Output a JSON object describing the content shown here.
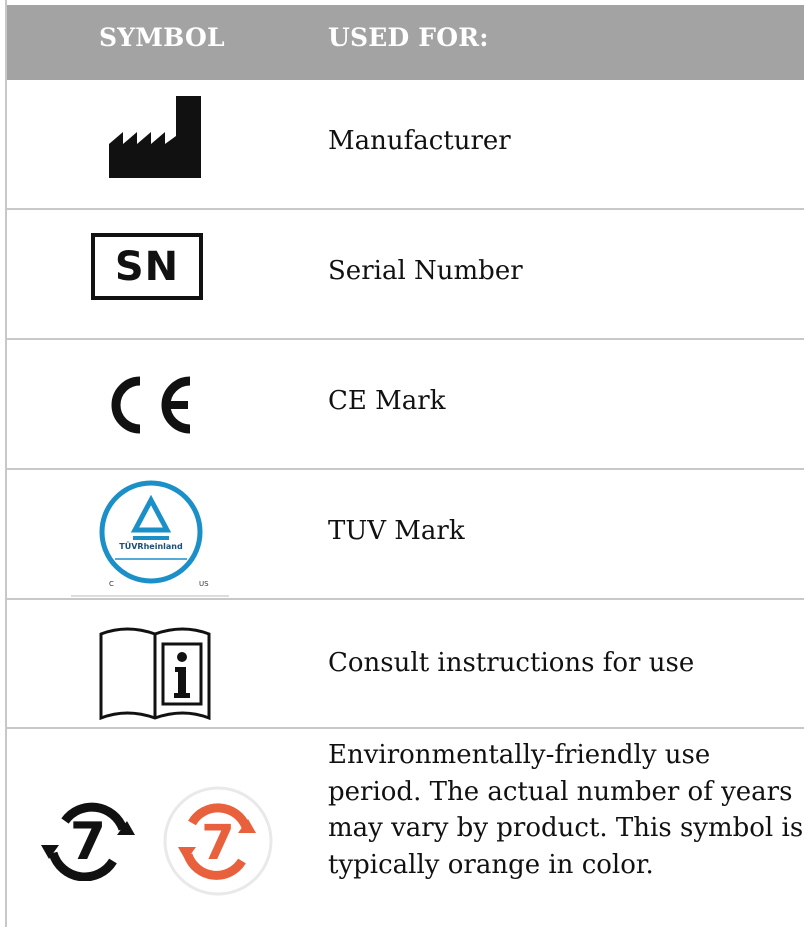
{
  "header": {
    "symbol_col": "SYMBOL",
    "used_for_col": "USED FOR:"
  },
  "rows": [
    {
      "icon": "manufacturer-icon",
      "label": "Manufacturer"
    },
    {
      "icon": "serial-number-icon",
      "icon_text": "SN",
      "label": "Serial Number"
    },
    {
      "icon": "ce-mark-icon",
      "label": "CE Mark"
    },
    {
      "icon": "tuv-mark-icon",
      "icon_text": "TÜVRheinland",
      "icon_corner_left": "C",
      "icon_corner_right": "US",
      "label": "TUV Mark"
    },
    {
      "icon": "consult-instructions-icon",
      "label": "Consult instructions for use"
    },
    {
      "icon": "environment-friendly-use-period-icon",
      "icon_text": "7",
      "label_lines": [
        "Environmentally-friendly use",
        "period. The actual number of years",
        "may vary by product. This symbol is",
        "typically orange in color."
      ]
    }
  ],
  "colors": {
    "header_bg": "#a3a3a3",
    "orange": "#e8603c",
    "tuv_blue": "#1b8fc7"
  }
}
